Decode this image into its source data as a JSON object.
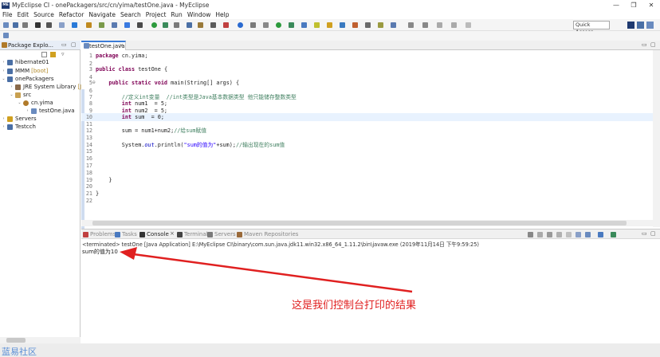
{
  "window": {
    "logo_text": "ME",
    "title": "MyEclipse CI - onePackagers/src/cn/yima/testOne.java - MyEclipse",
    "minimize": "—",
    "restore": "❐",
    "close": "✕"
  },
  "menu": [
    "File",
    "Edit",
    "Source",
    "Refactor",
    "Navigate",
    "Search",
    "Project",
    "Run",
    "Window",
    "Help"
  ],
  "toolbar": {
    "quick_access": "Quick Access"
  },
  "package_explorer": {
    "tab_label": "Package Explo...",
    "tree": [
      {
        "label": "hibernate01",
        "suffix": ""
      },
      {
        "label": "MMM",
        "suffix": "[boot]"
      },
      {
        "label": "onePackagers",
        "suffix": ""
      },
      {
        "label": "JRE System Library",
        "suffix": "[Ja"
      },
      {
        "label": "src",
        "suffix": ""
      },
      {
        "label": "cn.yima",
        "suffix": ""
      },
      {
        "label": "testOne.java",
        "suffix": ""
      },
      {
        "label": "Servers",
        "suffix": ""
      },
      {
        "label": "Testcch",
        "suffix": ""
      }
    ]
  },
  "editor": {
    "tab_label": "testOne.java",
    "line_numbers": [
      "1",
      "2",
      "3",
      "4",
      "5",
      "6",
      "7",
      "8",
      "9",
      "10",
      "11",
      "12",
      "13",
      "14",
      "15",
      "16",
      "17",
      "18",
      "19",
      "20",
      "21",
      "22"
    ],
    "line5_marker": "⊖",
    "code": {
      "l1_kw": "package",
      "l1_rest": " cn.yima;",
      "l3_kw": "public class",
      "l3_rest": " testOne {",
      "l5_kw": "    public static void",
      "l5_rest": " main(String[] args) {",
      "l7_comment": "        //定义int变量  //int类型是Java基本数据类型 他只能储存整数类型",
      "l8_kw": "        int",
      "l8_rest": " num1  = 5;",
      "l9_kw": "        int",
      "l9_rest": " num2  = 5;",
      "l10_kw": "        int",
      "l10_rest": " sum  = 0;",
      "l12_code": "        sum = num1+num2;",
      "l12_comment": "//给sum赋值",
      "l14_a": "        System.",
      "l14_field": "out",
      "l14_b": ".println(",
      "l14_str": "\"sum的值为\"",
      "l14_c": "+sum);",
      "l14_comment": "//输出现在的sum值",
      "l19": "    }",
      "l21": "}"
    }
  },
  "console": {
    "tabs": [
      "Problems",
      "Tasks",
      "Console",
      "Terminal",
      "Servers",
      "Maven Repositories"
    ],
    "active_tab": "Console",
    "status": "<terminated> testOne [Java Application] E:\\MyEclipse CI\\binary\\com.sun.java.jdk11.win32.x86_64_1.11.2\\bin\\javaw.exe (2019年11月14日 下午9:59:25)",
    "output": "sum的值为10"
  },
  "annotation": {
    "text": "这是我们控制台打印的结果",
    "color": "#e02020"
  },
  "watermark": "蓝易社区",
  "colors": {
    "keyword": "#7f0055",
    "comment": "#3f7f5f",
    "string": "#2a00ff",
    "field": "#0000c0",
    "current_line": "#e8f2fe"
  }
}
